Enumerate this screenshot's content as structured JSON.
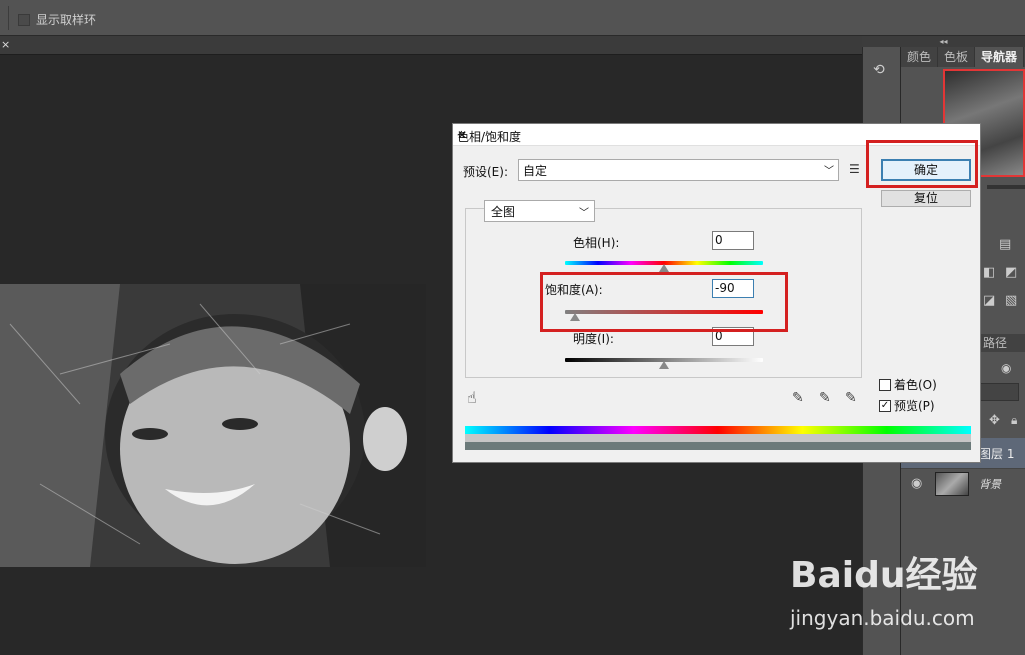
{
  "options_bar": {
    "sample_ring_label": "显示取样环"
  },
  "doc_tab": {
    "close_glyph": "×"
  },
  "right_panel": {
    "tabs": [
      "颜色",
      "色板",
      "导航器"
    ],
    "active_tab": "导航器",
    "layers_tab_label": "路径",
    "layers": [
      {
        "name": "图层 1",
        "selected": true
      },
      {
        "name": "背景",
        "selected": false
      }
    ]
  },
  "dialog": {
    "title": "色相/饱和度",
    "preset_label": "预设(E):",
    "preset_value": "自定",
    "ok_label": "确定",
    "reset_label": "复位",
    "channel_value": "全图",
    "hue": {
      "label": "色相(H):",
      "value": "0",
      "position": 0.5
    },
    "saturation": {
      "label": "饱和度(A):",
      "value": "-90",
      "position": 0.05
    },
    "lightness": {
      "label": "明度(I):",
      "value": "0",
      "position": 0.5
    },
    "colorize": {
      "label": "着色(O)",
      "checked": false
    },
    "preview": {
      "label": "预览(P)",
      "checked": true
    }
  },
  "watermark": {
    "brand": "Baidu经验",
    "url": "jingyan.baidu.com"
  },
  "colors": {
    "highlight_red": "#d42020",
    "ok_border": "#3c7fb1"
  }
}
